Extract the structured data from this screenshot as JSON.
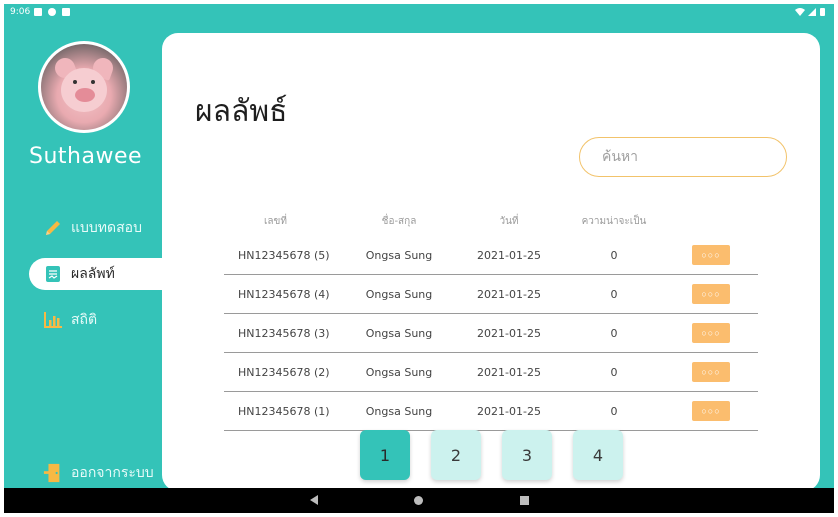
{
  "status_bar": {
    "time": "9:06"
  },
  "sidebar": {
    "user_name": "Suthawee",
    "items": [
      {
        "label": "แบบทดสอบ",
        "icon": "pencil-icon"
      },
      {
        "label": "ผลลัพท์",
        "icon": "document-icon"
      },
      {
        "label": "สถิติ",
        "icon": "bar-chart-icon"
      }
    ],
    "logout_label": "ออกจากระบบ"
  },
  "main": {
    "title": "ผลลัพธ์",
    "search": {
      "placeholder": "ค้นหา",
      "value": ""
    },
    "table": {
      "headers": [
        "เลขที่",
        "ชื่อ-สกุล",
        "วันที่",
        "ความน่าจะเป็น"
      ],
      "rows": [
        {
          "id": "HN12345678 (5)",
          "name": "Ongsa Sung",
          "date": "2021-01-25",
          "probability": "0"
        },
        {
          "id": "HN12345678 (4)",
          "name": "Ongsa Sung",
          "date": "2021-01-25",
          "probability": "0"
        },
        {
          "id": "HN12345678 (3)",
          "name": "Ongsa Sung",
          "date": "2021-01-25",
          "probability": "0"
        },
        {
          "id": "HN12345678 (2)",
          "name": "Ongsa Sung",
          "date": "2021-01-25",
          "probability": "0"
        },
        {
          "id": "HN12345678 (1)",
          "name": "Ongsa Sung",
          "date": "2021-01-25",
          "probability": "0"
        }
      ],
      "more_label": "○○○"
    },
    "pagination": {
      "pages": [
        "1",
        "2",
        "3",
        "4"
      ],
      "current": "1"
    }
  },
  "colors": {
    "accent": "#34c3b8",
    "button": "#fbbd6e",
    "search_border": "#f2c36b",
    "page_inactive": "#ccf2ee"
  }
}
